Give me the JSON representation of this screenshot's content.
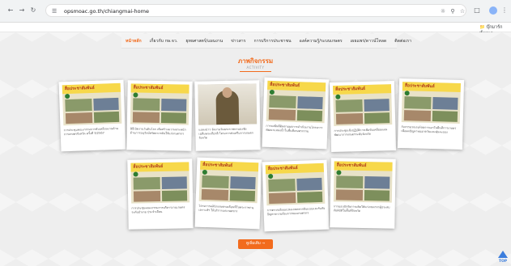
{
  "browser": {
    "url": "opsmoac.go.th/chiangmai-home",
    "bookmark_folder": "บุ๊กมาร์กทั้งหมด"
  },
  "menu": {
    "items": [
      {
        "label": "หน้าหลัก",
        "active": true
      },
      {
        "label": "เกี่ยวกับ กษ.จว.",
        "active": false
      },
      {
        "label": "ยุทธศาสตร์/แผนงาน",
        "active": false
      },
      {
        "label": "ข่าวสาร",
        "active": false
      },
      {
        "label": "การบริการประชาชน",
        "active": false
      },
      {
        "label": "องค์ความรู้/ระบบเกษตร",
        "active": false
      },
      {
        "label": "เผยแพร่/ดาวน์โหลด",
        "active": false
      },
      {
        "label": "ติดต่อเรา",
        "active": false
      }
    ]
  },
  "section": {
    "title": "ภาพกิจกรรม",
    "subtitle": "ACTIVITY"
  },
  "cards": [
    {
      "banner": "สื่อประชาสัมพันธ์",
      "text": "การประชุมคณะกรรมการขับเคลื่อนงานด้านการเกษตรจังหวัด ครั้งที่ 3/2567",
      "kind": "banner"
    },
    {
      "banner": "สื่อประชาสัมพันธ์",
      "text": "พิธีเปิดงานวันดินโลก เพื่อสร้างความตระหนักด้านการอนุรักษ์ทรัพยากรดินให้แก่เกษตรกร",
      "kind": "banner"
    },
    {
      "banner": "",
      "text": "แถลงข่าว จัดงานวันพระราชทานธงชัยเฉลิมพระเกียรติ โครงการส่งเสริมการเกษตรจังหวัด",
      "kind": "photo"
    },
    {
      "banner": "สื่อประชาสัมพันธ์",
      "text": "การลงพื้นที่ติดตามผลการดำเนินงานโครงการพัฒนาแหล่งน้ำในพื้นที่เกษตรกรรม",
      "kind": "banner"
    },
    {
      "banner": "สื่อประชาสัมพันธ์",
      "text": "การประชุมเชิงปฏิบัติการเพื่อขับเคลื่อนแผนพัฒนาการเกษตรระดับจังหวัด",
      "kind": "banner"
    },
    {
      "banner": "สื่อประชาสัมพันธ์",
      "text": "กิจกรรมรณรงค์ลดการเผาในพื้นที่การเกษตร เพื่อลดปัญหาหมอกควันและฝุ่นละออง",
      "kind": "banner"
    },
    {
      "banner": "สื่อประชาสัมพันธ์",
      "text": "การประชุมคณะกรรมการบริหารงานเกษตรระดับอำเภอ ประจำเดือน",
      "kind": "banner"
    },
    {
      "banner": "สื่อประชาสัมพันธ์",
      "text": "โครงการคลินิกเกษตรเคลื่อนที่ในพระราชานุเคราะห์ฯ ให้บริการแก่เกษตรกร",
      "kind": "banner"
    },
    {
      "banner": "สื่อประชาสัมพันธ์",
      "text": "การตรวจเยี่ยมแปลงเกษตรกรต้นแบบและรับฟังปัญหาความต้องการของเกษตรกร",
      "kind": "banner"
    },
    {
      "banner": "สื่อประชาสัมพันธ์",
      "text": "การมอบปัจจัยการผลิตให้แก่เกษตรกรผู้ประสบภัยพิบัติในพื้นที่จังหวัด",
      "kind": "banner"
    }
  ],
  "more_button": "ดูเพิ่มเติม →",
  "top_button": "TOP"
}
